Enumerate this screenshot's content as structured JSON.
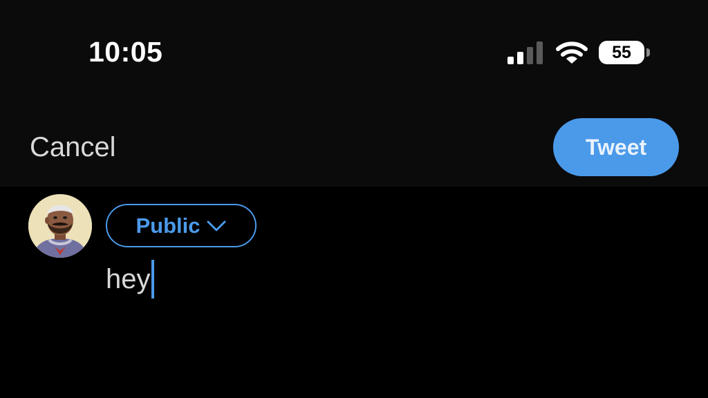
{
  "status_bar": {
    "time": "10:05",
    "battery_level": "55",
    "signal_bars_filled": 2,
    "signal_bars_total": 4,
    "icons": [
      "signal-icon",
      "wifi-icon",
      "battery-icon"
    ]
  },
  "header": {
    "cancel_label": "Cancel",
    "tweet_label": "Tweet"
  },
  "composer": {
    "audience_label": "Public",
    "text_value": "hey",
    "avatar_icon": "avatar"
  },
  "colors": {
    "accent": "#4b9aea",
    "background": "#000000",
    "header_background": "#0b0b0c",
    "text": "#d9d9d9"
  }
}
